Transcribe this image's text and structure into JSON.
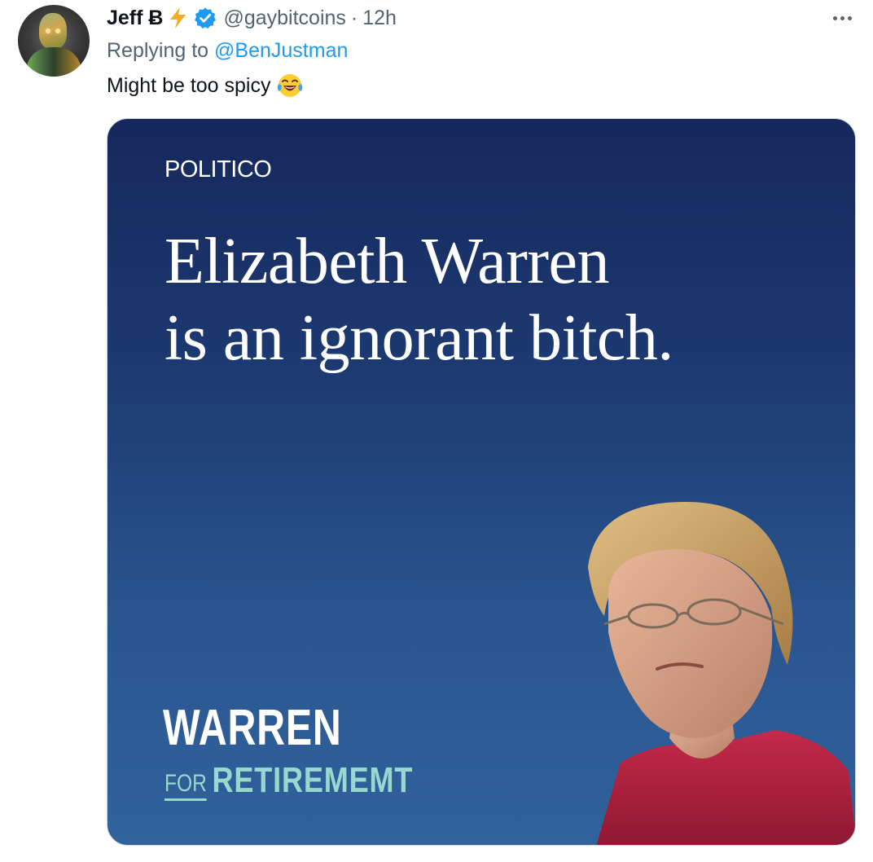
{
  "tweet": {
    "author_name": "Jeff Ƀ",
    "handle": "@gaybitcoins",
    "separator": "·",
    "time": "12h",
    "replying_prefix": "Replying to",
    "replying_to": "@BenJustman",
    "text": "Might be too spicy",
    "emoji_name": "face-with-tears-of-joy-icon"
  },
  "media": {
    "brand": "POLITICO",
    "headline_line1": "Elizabeth Warren",
    "headline_line2": "is an ignorant bitch.",
    "logo_line1": "WARREN",
    "logo_for": "FOR",
    "logo_line2": "RETIREMEMT"
  },
  "colors": {
    "link": "#1d9bf0",
    "secondary_text": "#536471",
    "verified": "#1d9bf0",
    "bolt": "#f7a928",
    "media_bg_top": "#16285c",
    "media_bg_bottom": "#31629c",
    "logo_accent": "#9ad7cf"
  }
}
